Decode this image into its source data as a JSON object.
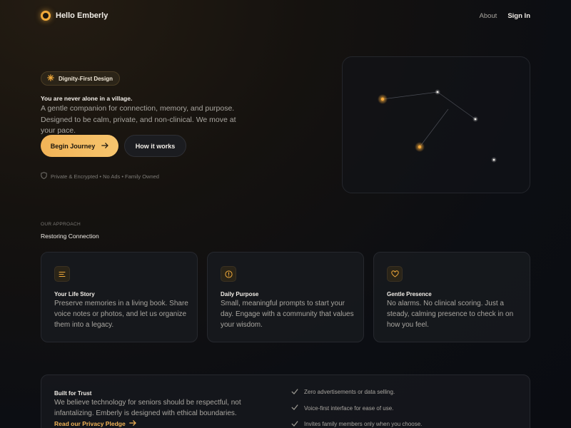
{
  "nav": {
    "brand": "Hello Emberly",
    "about": "About",
    "sign_in": "Sign In"
  },
  "hero": {
    "badge": "Dignity-First Design",
    "tagline_small": "You are never alone in a village.",
    "description": "A gentle companion for connection, memory, and purpose. Designed to be calm, private, and non-clinical. We move at your pace.",
    "primary_button": "Begin Journey",
    "secondary_button": "How it works",
    "trust_line": "Private & Encrypted • No Ads • Family Owned"
  },
  "approach": {
    "kicker": "OUR APPROACH",
    "title": "Restoring Connection",
    "cards": [
      {
        "icon": "book-lines-icon",
        "title": "Your Life Story",
        "description": "Preserve memories in a living book. Share voice notes or photos, and let us organize them into a legacy."
      },
      {
        "icon": "info-circle-icon",
        "title": "Daily Purpose",
        "description": "Small, meaningful prompts to start your day. Engage with a community that values your wisdom."
      },
      {
        "icon": "heart-icon",
        "title": "Gentle Presence",
        "description": "No alarms. No clinical scoring. Just a steady, calming presence to check in on how you feel."
      }
    ]
  },
  "trust": {
    "title": "Built for Trust",
    "description": "We believe technology for seniors should be respectful, not infantalizing. Emberly is designed with ethical boundaries.",
    "link": "Read our Privacy Pledge",
    "items": [
      "Zero advertisements or data selling.",
      "Voice-first interface for ease of use.",
      "Invites family members only when you choose."
    ]
  },
  "colors": {
    "accent": "#f2b357",
    "background": "#0c0e13",
    "card": "#18191e"
  }
}
